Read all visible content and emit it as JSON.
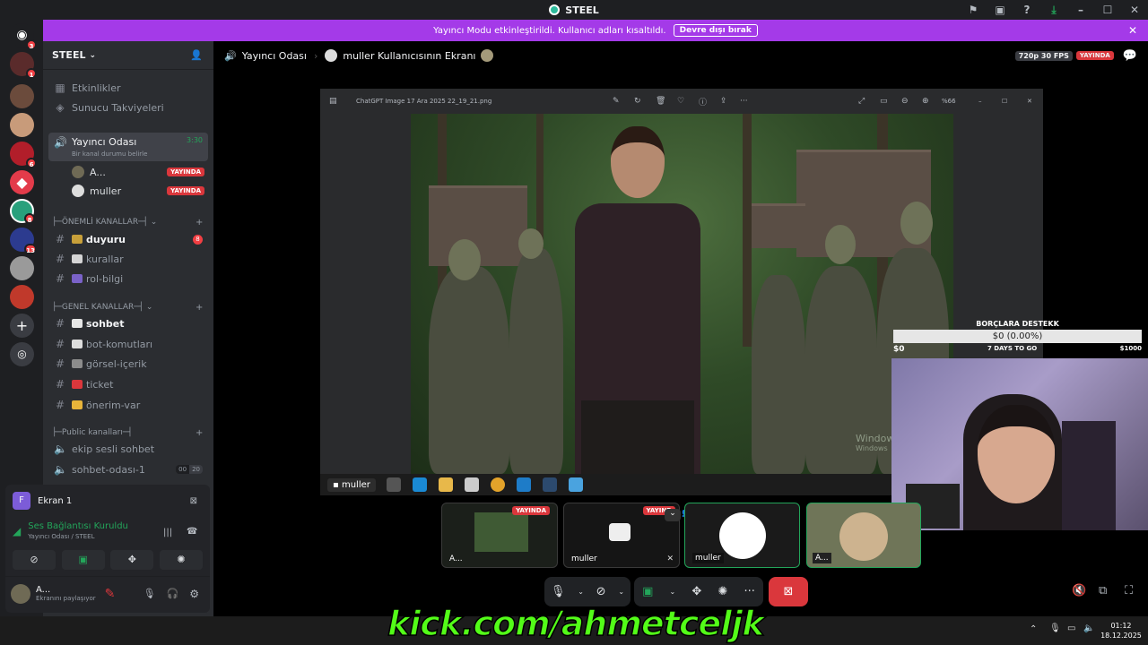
{
  "window": {
    "title": "STEEL"
  },
  "banner": {
    "text": "Yayıncı Modu etkinleştirildi. Kullanıcı adları kısaltıldı.",
    "button": "Devre dışı bırak"
  },
  "servers": {
    "badges": [
      "3",
      "1",
      "6",
      "8",
      "13"
    ]
  },
  "sidebar": {
    "guild_name": "STEEL",
    "events": "Etkinlikler",
    "boosts": "Sunucu Takviyeleri",
    "voice_active": {
      "name": "Yayıncı Odası",
      "time": "3:30",
      "status": "Bir kanal durumu belirle"
    },
    "voice_users": [
      {
        "name": "A...",
        "badge": "YAYINDA"
      },
      {
        "name": "muller",
        "badge": "YAYINDA"
      }
    ],
    "cat_important": "ÖNEMLİ KANALLAR",
    "important_channels": [
      {
        "name": "duyuru",
        "count": "8"
      },
      {
        "name": "kurallar"
      },
      {
        "name": "rol-bilgi"
      }
    ],
    "cat_general": "GENEL KANALLAR",
    "general_channels": [
      "sohbet",
      "bot-komutları",
      "görsel-içerik",
      "ticket",
      "önerim-var"
    ],
    "cat_public": "Public kanalları",
    "public_channels": [
      "ekip sesli sohbet",
      "sohbet-odası-1"
    ],
    "public_room_counts": [
      "00",
      "20"
    ]
  },
  "screen_panel": {
    "label": "Ekran 1",
    "avatar_letter": "F"
  },
  "voice_panel": {
    "status": "Ses Bağlantısı Kuruldu",
    "channel": "Yayıncı Odası / STEEL"
  },
  "user_panel": {
    "name": "A...",
    "status": "Ekranını paylaşıyor"
  },
  "header": {
    "channel": "Yayıncı Odası",
    "screen_title": "muller Kullanıcısının Ekranı",
    "quality": "720p 30 FPS",
    "live": "YAYINDA"
  },
  "viewer": {
    "filename": "ChatGPT Image 17 Ara 2025 22_19_21.png",
    "zoom": "%66",
    "watermark_line1": "Window",
    "watermark_line2": "Windows",
    "taskbar_user": "muller"
  },
  "donation": {
    "title": "BORÇLARA DESTEKK",
    "amount": "$0 (0.00%)",
    "left": "$0",
    "middle": "7 DAYS TO GO",
    "right": "$1000",
    "progress": 0
  },
  "thumbnails": [
    {
      "label": "A...",
      "badge": "YAYINDA"
    },
    {
      "label": "muller",
      "badge": "YAYIND"
    },
    {
      "label": "muller"
    },
    {
      "label": "A..."
    }
  ],
  "kick": "kick.com/ahmetceljk",
  "clock": {
    "time": "01:12",
    "date": "18.12.2025"
  },
  "colors": {
    "accent": "#a43ae8",
    "live": "#da373c",
    "green": "#23a55a",
    "kick": "#53fc18"
  }
}
